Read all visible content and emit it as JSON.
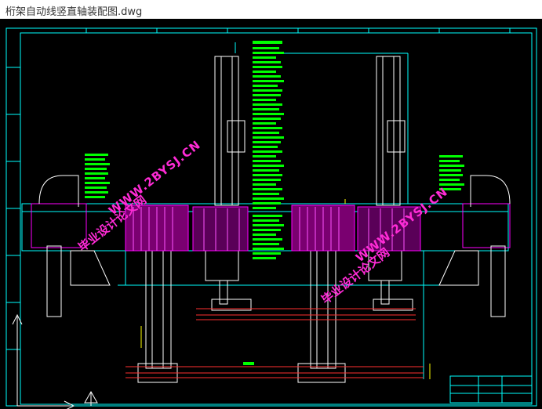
{
  "window": {
    "title": "桁架自动线竖直轴装配图.dwg"
  },
  "watermarks": [
    {
      "cn": "毕业设计论文网",
      "url": "WWW.2BYSJ.CN"
    },
    {
      "cn": "毕业设计论文网",
      "url": "WWW.2BYSJ.CN"
    }
  ],
  "colors": {
    "background": "#000000",
    "frame": "#00ffff",
    "magenta": "#ff00ff",
    "green": "#00ff00",
    "red": "#ff3030",
    "white": "#ffffff",
    "yellow": "#ffff00"
  },
  "icons": [
    "ucs-axis-icon",
    "rail-dimension-icon"
  ]
}
